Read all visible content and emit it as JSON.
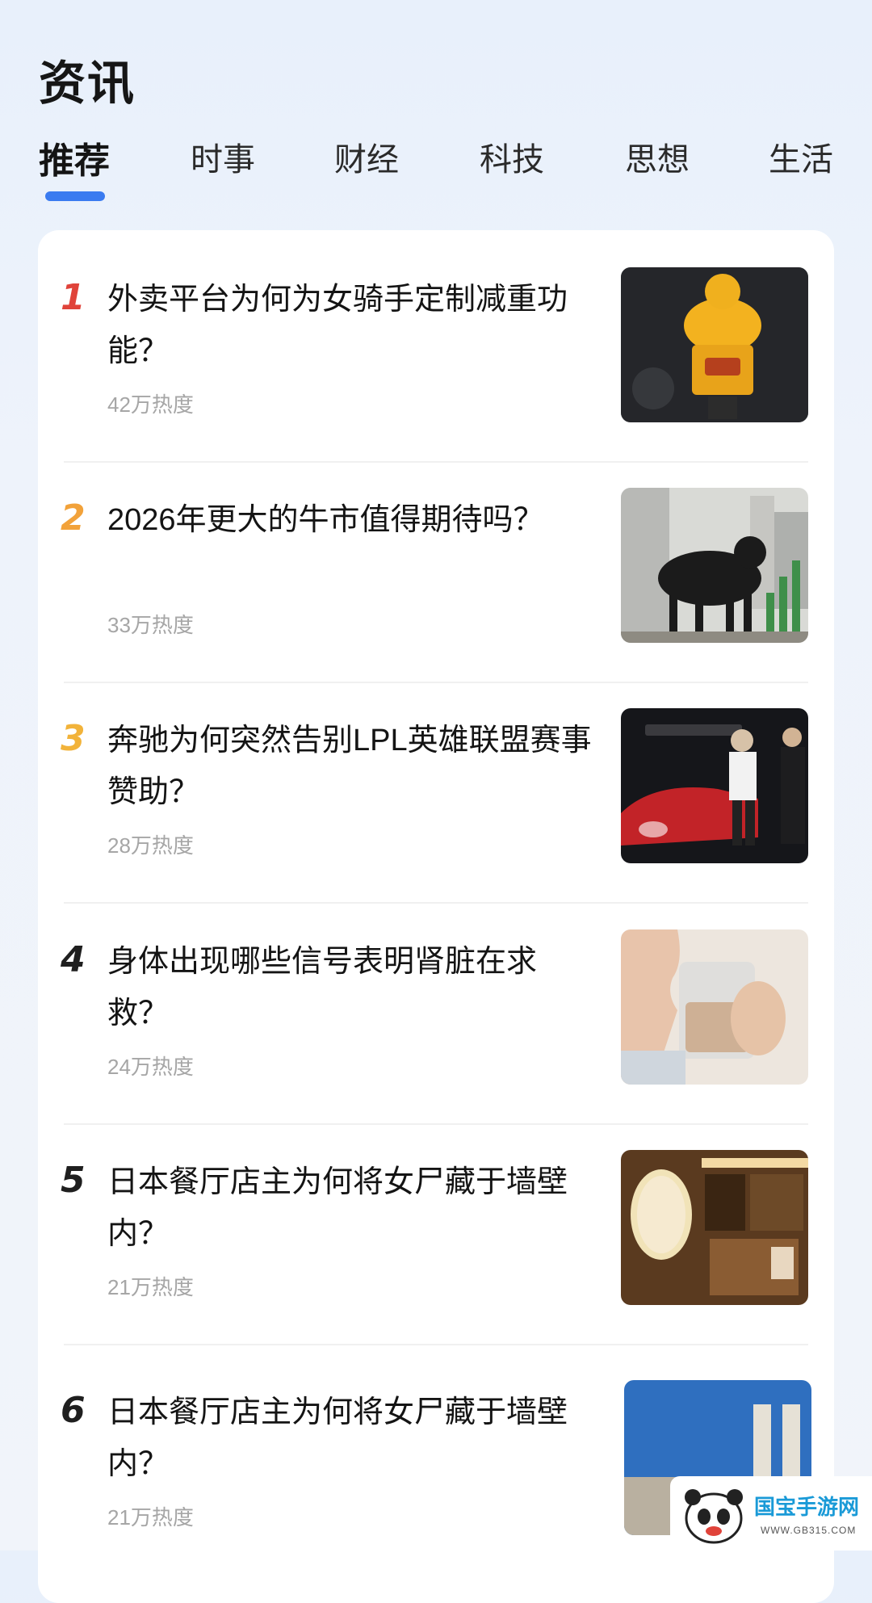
{
  "header": {
    "title": "资讯"
  },
  "tabs": [
    {
      "label": "推荐",
      "active": true
    },
    {
      "label": "时事",
      "active": false
    },
    {
      "label": "财经",
      "active": false
    },
    {
      "label": "科技",
      "active": false
    },
    {
      "label": "思想",
      "active": false
    },
    {
      "label": "生活",
      "active": false
    }
  ],
  "news": [
    {
      "rank": "1",
      "rank_color": "#e0433a",
      "title": "外卖平台为何为女骑手定制减重功能？",
      "heat": "42万热度",
      "thumb": "delivery-rider-image"
    },
    {
      "rank": "2",
      "rank_color": "#f2a23a",
      "title": "2026年更大的牛市值得期待吗？",
      "heat": "33万热度",
      "thumb": "bull-market-image"
    },
    {
      "rank": "3",
      "rank_color": "#f2b33a",
      "title": "奔驰为何突然告别LPL英雄联盟赛事赞助？",
      "heat": "28万热度",
      "thumb": "mercedes-event-image"
    },
    {
      "rank": "4",
      "rank_color": "#1f1f1f",
      "title": "身体出现哪些信号表明肾脏在求救？",
      "heat": "24万热度",
      "thumb": "drinking-water-image"
    },
    {
      "rank": "5",
      "rank_color": "#1f1f1f",
      "title": "日本餐厅店主为何将女尸藏于墙壁内？",
      "heat": "21万热度",
      "thumb": "japanese-restaurant-image"
    },
    {
      "rank": "6",
      "rank_color": "#1f1f1f",
      "title": "日本餐厅店主为何将女尸藏于墙壁内？",
      "heat": "21万热度",
      "thumb": "restaurant-exterior-image"
    }
  ],
  "watermark": {
    "name": "国宝手游网",
    "url": "WWW.GB315.COM"
  }
}
